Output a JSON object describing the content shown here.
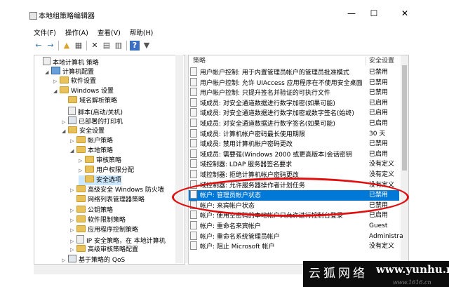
{
  "window": {
    "title": "本地组策略编辑器",
    "controls": {
      "minimize": "—",
      "maximize": "☐",
      "close": "✕"
    }
  },
  "menu": [
    "文件(F)",
    "操作(A)",
    "查看(V)",
    "帮助(H)"
  ],
  "toolbar": {
    "icons": [
      "back-arrow-icon",
      "forward-arrow-icon",
      "up-folder-icon",
      "show-hide-tree-icon",
      "delete-icon",
      "properties-icon",
      "export-list-icon",
      "help-icon",
      "filter-icon"
    ],
    "glyphs": {
      "back": "←",
      "forward": "→",
      "up": "▲",
      "tree": "▦",
      "delete": "✕",
      "props": "▤",
      "export": "▥",
      "help": "?",
      "filter": "▼"
    }
  },
  "tree": [
    {
      "label": "本地计算机 策略",
      "level": 0,
      "icon": "policy",
      "twisty": ""
    },
    {
      "label": "计算机配置",
      "level": 1,
      "icon": "computer",
      "twisty": "◢"
    },
    {
      "label": "软件设置",
      "level": 2,
      "icon": "folder",
      "twisty": "▷"
    },
    {
      "label": "Windows 设置",
      "level": 2,
      "icon": "folder",
      "twisty": "◢"
    },
    {
      "label": "域名解析策略",
      "level": 3,
      "icon": "folder",
      "twisty": ""
    },
    {
      "label": "脚本(启动/关机)",
      "level": 3,
      "icon": "doc",
      "twisty": ""
    },
    {
      "label": "已部署的打印机",
      "level": 3,
      "icon": "printer",
      "twisty": "▷"
    },
    {
      "label": "安全设置",
      "level": 3,
      "icon": "folder",
      "twisty": "◢"
    },
    {
      "label": "帐户策略",
      "level": 4,
      "icon": "folder",
      "twisty": "▷"
    },
    {
      "label": "本地策略",
      "level": 4,
      "icon": "folder",
      "twisty": "◢"
    },
    {
      "label": "审核策略",
      "level": 5,
      "icon": "folder",
      "twisty": "▷"
    },
    {
      "label": "用户权限分配",
      "level": 5,
      "icon": "folder",
      "twisty": "▷"
    },
    {
      "label": "安全选项",
      "level": 5,
      "icon": "folder",
      "twisty": "",
      "selected": true
    },
    {
      "label": "高级安全 Windows 防火墙",
      "level": 4,
      "icon": "folder",
      "twisty": "▷"
    },
    {
      "label": "网络列表管理器策略",
      "level": 4,
      "icon": "folder",
      "twisty": ""
    },
    {
      "label": "公钥策略",
      "level": 4,
      "icon": "folder",
      "twisty": "▷"
    },
    {
      "label": "软件限制策略",
      "level": 4,
      "icon": "folder",
      "twisty": "▷"
    },
    {
      "label": "应用程序控制策略",
      "level": 4,
      "icon": "folder",
      "twisty": "▷"
    },
    {
      "label": "IP 安全策略，在 本地计算机",
      "level": 4,
      "icon": "policy",
      "twisty": "▷"
    },
    {
      "label": "高级审核策略配置",
      "level": 4,
      "icon": "folder",
      "twisty": "▷"
    },
    {
      "label": "基于策略的 QoS",
      "level": 3,
      "icon": "chart",
      "twisty": "▷"
    }
  ],
  "policy_list": {
    "columns": {
      "policy": "策略",
      "setting": "安全设置"
    },
    "rows": [
      {
        "name": "用户帐户控制: 用于内置管理员帐户的管理员批准模式",
        "value": "已禁用"
      },
      {
        "name": "用户帐户控制: 允许 UIAccess 应用程序在不使用安全桌面...",
        "value": "已禁用"
      },
      {
        "name": "用户帐户控制: 只提升签名并验证的可执行文件",
        "value": "已禁用"
      },
      {
        "name": "域成员: 对安全通道数据进行数字加密(如果可能)",
        "value": "已启用"
      },
      {
        "name": "域成员: 对安全通道数据进行数字加密或数字签名(始终)",
        "value": "已启用"
      },
      {
        "name": "域成员: 对安全通道数据进行数字签名(如果可能)",
        "value": "已启用"
      },
      {
        "name": "域成员: 计算机帐户密码最长使用期限",
        "value": "30 天"
      },
      {
        "name": "域成员: 禁用计算机帐户密码更改",
        "value": "已禁用"
      },
      {
        "name": "域成员: 需要强(Windows 2000 或更高版本)会话密钥",
        "value": "已启用"
      },
      {
        "name": "域控制器: LDAP 服务器签名要求",
        "value": "没有定义"
      },
      {
        "name": "域控制器: 拒绝计算机帐户密码更改",
        "value": "没有定义"
      },
      {
        "name": "域控制器: 允许服务器操作者计划任务",
        "value": "没有定义"
      },
      {
        "name": "帐户: 管理员帐户状态",
        "value": "已禁用",
        "selected": true
      },
      {
        "name": "帐户: 来宾帐户状态",
        "value": "已禁用"
      },
      {
        "name": "帐户: 使用空密码的本地帐户只允许进行控制台登录",
        "value": "已启用"
      },
      {
        "name": "帐户: 重命名来宾帐户",
        "value": "Guest"
      },
      {
        "name": "帐户: 重命名系统管理员帐户",
        "value": "Administra"
      },
      {
        "name": "帐户: 阻止 Microsoft 帐户",
        "value": "没有定义"
      }
    ]
  },
  "watermark": {
    "brand": "云狐网络",
    "domain": "www.yunhu.net",
    "sub": "www.1616.cn"
  },
  "colors": {
    "selection": "#0078d7",
    "tree_selection": "#cce8ff",
    "highlight_ring": "#e01010"
  }
}
